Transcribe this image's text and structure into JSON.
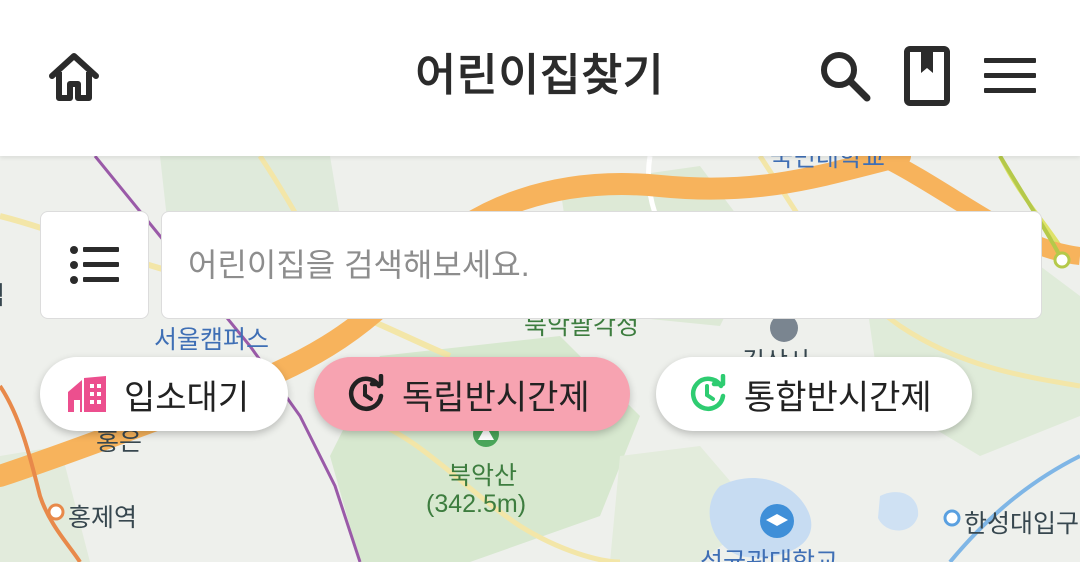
{
  "header": {
    "title": "어린이집찾기",
    "home_icon": "home-icon",
    "search_icon": "search-icon",
    "bookmark_icon": "bookmark-icon",
    "menu_icon": "hamburger-menu-icon"
  },
  "search": {
    "placeholder": "어린이집을 검색해보세요.",
    "value": "",
    "list_icon": "list-icon"
  },
  "filters": [
    {
      "label": "입소대기",
      "icon": "house-icon",
      "icon_color": "#ec4f8e",
      "active": false
    },
    {
      "label": "독립반시간제",
      "icon": "clock-refresh-icon",
      "icon_color": "#222222",
      "active": true,
      "bg_color": "#f7a3b1"
    },
    {
      "label": "통합반시간제",
      "icon": "clock-refresh-icon",
      "icon_color": "#2ecc71",
      "active": false
    }
  ],
  "map": {
    "labels": {
      "campus": "서울캠퍼스",
      "station_left": "역",
      "hongje": "홍제역",
      "bukaksan": "북악산",
      "bukaksan_height": "(342.5m)",
      "hansung": "한성대입구",
      "partial_top": "국민대학교",
      "partial_mid": "북악팔각정",
      "partial_left": "홍은",
      "partial_right": "길상사",
      "partial_bottom": "성균관대학교"
    },
    "colors": {
      "road_major": "#f7b35c",
      "road_minor": "#f3e6a8",
      "park": "#d7e8cf",
      "water": "#c7dcf2",
      "subway_purple": "#9a5aa8",
      "subway_orange": "#e8894a"
    }
  }
}
